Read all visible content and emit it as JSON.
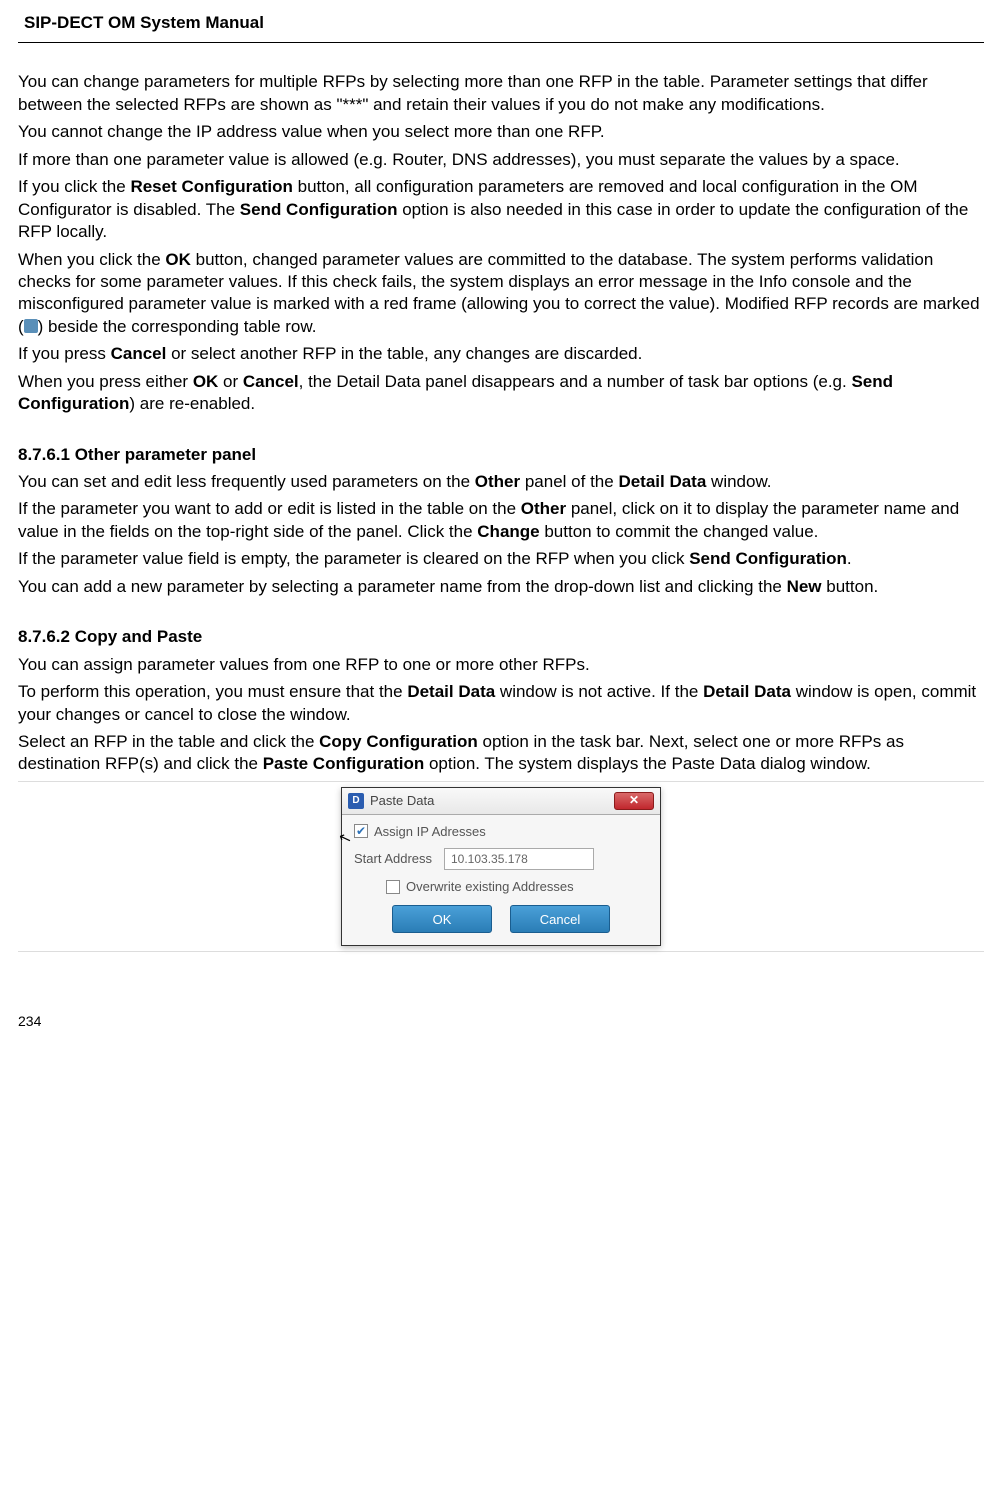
{
  "header": {
    "title": "SIP-DECT OM System Manual"
  },
  "body": {
    "p1_pre": "You can change parameters for multiple RFPs by selecting more than one RFP in the table. Parameter settings that differ between the selected RFPs are shown as \"***\" and retain their values if you do not make any modifications.",
    "p2": "You cannot change the IP address value when you select more than one RFP.",
    "p3": "If more than one parameter value is allowed (e.g. Router, DNS addresses), you must separate the values by a space.",
    "p4_a": "If you click the ",
    "p4_b": "Reset Configuration",
    "p4_c": " button, all configuration parameters are removed and local configuration in the OM Configurator is disabled. The ",
    "p4_d": "Send Configuration",
    "p4_e": " option is also needed in this case in order to update the configuration of the RFP locally.",
    "p5_a": "When you click the ",
    "p5_b": "OK",
    "p5_c": " button, changed parameter values are committed to the database. The system performs validation checks for some parameter values. If this check fails, the system displays an error message in the Info console and the misconfigured parameter value is marked with a red frame (allowing you to correct the value). Modified RFP records are marked (",
    "p5_d": ") beside the corresponding table row.",
    "p6_a": "If you press ",
    "p6_b": "Cancel",
    "p6_c": " or select another RFP in the table, any changes are discarded.",
    "p7_a": "When you press either ",
    "p7_b": "OK",
    "p7_c": " or ",
    "p7_d": "Cancel",
    "p7_e": ", the Detail Data panel disappears and a number of task bar options (e.g. ",
    "p7_f": "Send Configuration",
    "p7_g": ") are re-enabled.",
    "sec1_heading": "8.7.6.1 Other parameter panel",
    "s1p1_a": "You can set and edit less frequently used parameters on the ",
    "s1p1_b": "Other",
    "s1p1_c": " panel of the ",
    "s1p1_d": "Detail Data",
    "s1p1_e": " window.",
    "s1p2_a": "If the parameter you want to add or edit is listed in the table on the ",
    "s1p2_b": "Other",
    "s1p2_c": " panel, click on it to display the parameter name and value in the fields on the top-right side of the panel. Click the ",
    "s1p2_d": "Change",
    "s1p2_e": " button to commit the changed value.",
    "s1p3_a": "If the parameter value field is empty, the parameter is cleared on the RFP when you click ",
    "s1p3_b": "Send Configuration",
    "s1p3_c": ".",
    "s1p4_a": "You can add a new parameter by selecting a parameter name from the drop-down list and clicking the ",
    "s1p4_b": "New",
    "s1p4_c": " button.",
    "sec2_heading": "8.7.6.2 Copy and Paste",
    "s2p1": "You can assign parameter values from one RFP to one or more other RFPs.",
    "s2p2_a": "To perform this operation, you must ensure that the ",
    "s2p2_b": "Detail Data",
    "s2p2_c": " window is not active. If the ",
    "s2p2_d": "Detail Data",
    "s2p2_e": " window is open, commit your changes or cancel to close the window.",
    "s2p3_a": "Select an RFP in the table and click the ",
    "s2p3_b": "Copy Configuration",
    "s2p3_c": " option in the task bar. Next, select one or more RFPs as destination RFP(s) and click the ",
    "s2p3_d": "Paste Configuration",
    "s2p3_e": " option. The system displays the Paste Data dialog window."
  },
  "dialog": {
    "icon_text": "D",
    "title": "Paste Data",
    "close": "✕",
    "assign_check": "✔",
    "assign_label": "Assign IP Adresses",
    "start_label": "Start Address",
    "start_value": "10.103.35.178",
    "overwrite_label": "Overwrite existing Addresses",
    "ok": "OK",
    "cancel": "Cancel"
  },
  "page_number": "234"
}
